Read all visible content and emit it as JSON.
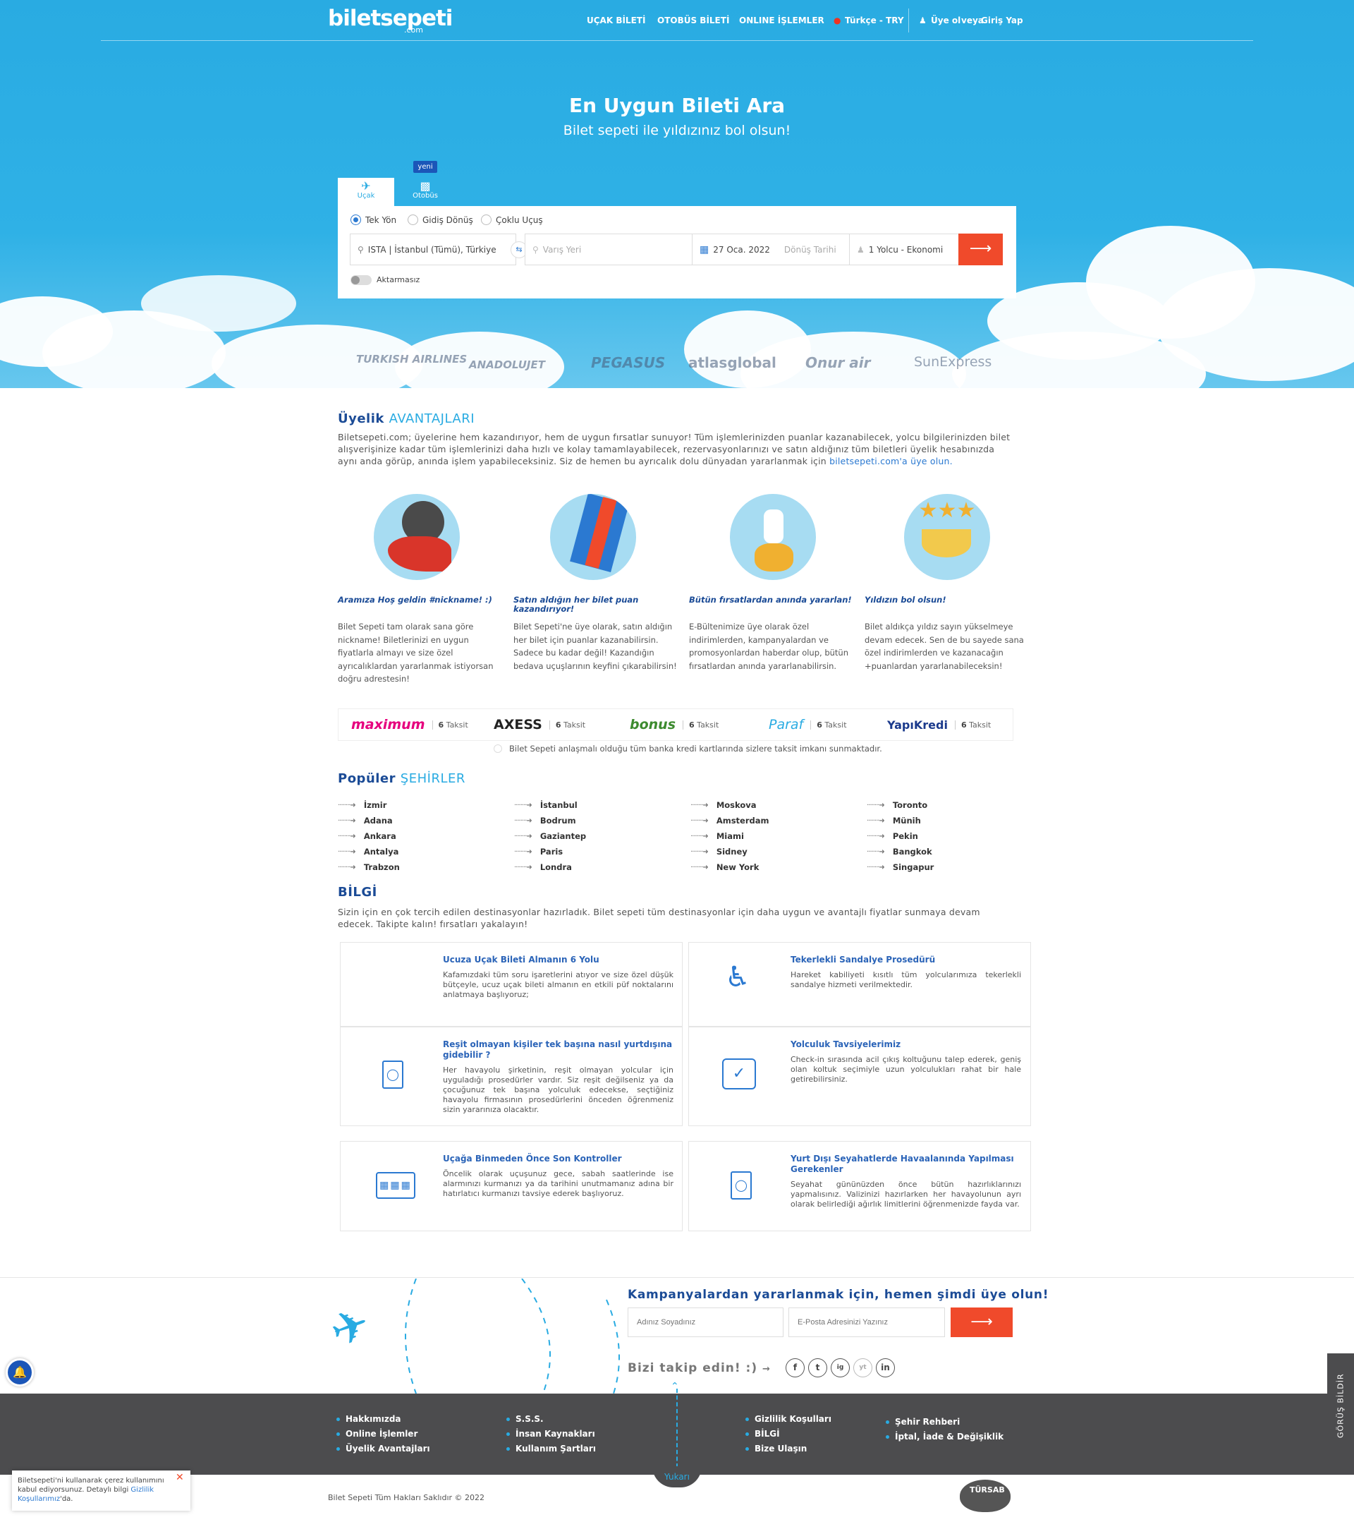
{
  "header": {
    "logo": "biletsepeti",
    "logo_sub": ".com",
    "nav": {
      "flight": "UÇAK BİLETİ",
      "bus": "OTOBÜS BİLETİ",
      "online": "ONLINE İŞLEMLER",
      "language": "Türkçe - TRY",
      "signup": "Üye ol",
      "or": "veya",
      "login": "Giriş Yap"
    }
  },
  "hero": {
    "title": "En Uygun Bileti Ara",
    "subtitle": "Bilet sepeti ile yıldızınız bol olsun!"
  },
  "search": {
    "tabs": {
      "flight": "Uçak",
      "bus": "Otobüs",
      "new_badge": "yeni"
    },
    "trip_types": {
      "one_way": "Tek Yön",
      "round_trip": "Gidiş Dönüş",
      "multi": "Çoklu Uçuş"
    },
    "from_value": "ISTA | İstanbul (Tümü), Türkiye",
    "to_placeholder": "Varış Yeri",
    "depart_date": "27 Oca. 2022",
    "return_placeholder": "Dönüş Tarihi",
    "passengers": "1 Yolcu - Ekonomi",
    "direct_label": "Aktarmasız"
  },
  "airlines": [
    "TURKISH AIRLINES",
    "ANADOLUJET",
    "PEGASUS",
    "atlasglobal",
    "Onur air",
    "SunExpress"
  ],
  "advantages": {
    "title_main": "Üyelik",
    "title_accent": "AVANTAJLARI",
    "intro": "Biletsepeti.com; üyelerine hem kazandırıyor, hem de uygun fırsatlar sunuyor! Tüm işlemlerinizden puanlar kazanabilecek, yolcu bilgilerinizden bilet alışverişinize kadar tüm işlemlerinizi daha hızlı ve kolay tamamlayabilecek, rezervasyonlarınızı ve satın aldığınız tüm biletleri üyelik hesabınızda aynı anda görüp, anında işlem yapabileceksiniz. Siz de hemen bu ayrıcalık dolu dünyadan yararlanmak için",
    "intro_link": "biletsepeti.com'a üye olun.",
    "items": [
      {
        "title": "Aramıza Hoş geldin #nickname! :)",
        "text": "Bilet Sepeti tam olarak sana göre nickname! Biletlerinizi en uygun fiyatlarla almayı ve size özel ayrıcalıklardan yararlanmak istiyorsan doğru adrestesin!"
      },
      {
        "title": "Satın aldığın her bilet puan kazandırıyor!",
        "text": "Bilet Sepeti'ne üye olarak, satın aldığın her bilet için puanlar kazanabilirsin. Sadece bu kadar değil! Kazandığın bedava uçuşlarının keyfini çıkarabilirsin!"
      },
      {
        "title": "Bütün fırsatlardan anında yararlan!",
        "text": "E-Bültenimize üye olarak özel indirimlerden, kampanyalardan ve promosyonlardan haberdar olup, bütün fırsatlardan anında yararlanabilirsin."
      },
      {
        "title": "Yıldızın bol olsun!",
        "text": "Bilet aldıkça yıldız sayın yükselmeye devam edecek. Sen de bu sayede sana özel indirimlerden ve kazanacağın +puanlardan yararlanabileceksin!"
      }
    ]
  },
  "banks": {
    "items": [
      {
        "name": "maximum",
        "count": "6",
        "label": "Taksit",
        "color": "#e6007e"
      },
      {
        "name": "AXESS",
        "count": "6",
        "label": "Taksit",
        "color": "#222222"
      },
      {
        "name": "bonus",
        "count": "6",
        "label": "Taksit",
        "color": "#3d8b2f"
      },
      {
        "name": "Paraf",
        "count": "6",
        "label": "Taksit",
        "color": "#29abe2"
      },
      {
        "name": "YapıKredi",
        "count": "6",
        "label": "Taksit",
        "color": "#1b3a8c"
      }
    ],
    "note": "Bilet Sepeti anlaşmalı olduğu tüm banka kredi kartlarında sizlere taksit imkanı sunmaktadır."
  },
  "cities": {
    "title_main": "Popüler",
    "title_accent": "ŞEHİRLER",
    "columns": [
      [
        "İzmir",
        "Adana",
        "Ankara",
        "Antalya",
        "Trabzon"
      ],
      [
        "İstanbul",
        "Bodrum",
        "Gaziantep",
        "Paris",
        "Londra"
      ],
      [
        "Moskova",
        "Amsterdam",
        "Miami",
        "Sidney",
        "New York"
      ],
      [
        "Toronto",
        "Münih",
        "Pekin",
        "Bangkok",
        "Singapur"
      ]
    ]
  },
  "info": {
    "title": "BİLGİ",
    "intro": "Sizin için en çok tercih edilen destinasyonlar hazırladık. Bilet sepeti tüm destinasyonlar için daha uygun ve avantajlı fiyatlar sunmaya devam edecek. Takipte kalın! fırsatları yakalayın!",
    "cards": [
      {
        "title": "Ucuza Uçak Bileti Almanın 6 Yolu",
        "text": "Kafamızdaki tüm soru işaretlerini atıyor ve size özel düşük bütçeyle, ucuz uçak bileti almanın en etkili püf noktalarını anlatmaya başlıyoruz;",
        "icon": "blank"
      },
      {
        "title": "Tekerlekli Sandalye Prosedürü",
        "text": "Hareket kabiliyeti kısıtlı tüm yolcularımıza tekerlekli sandalye hizmeti verilmektedir.",
        "icon": "wheelchair-icon"
      },
      {
        "title": "Reşit olmayan kişiler tek başına nasıl yurtdışına gidebilir ?",
        "text": "Her havayolu şirketinin, reşit olmayan yolcular için uyguladığı prosedürler vardır. Siz reşit değilseniz ya da çocuğunuz tek başına yolculuk edecekse, seçtiğiniz havayolu firmasının prosedürlerini önceden öğrenmeniz sizin yararınıza olacaktır.",
        "icon": "passport-icon"
      },
      {
        "title": "Yolculuk Tavsiyelerimiz",
        "text": "Check-in sırasında acil çıkış koltuğunu talep ederek, geniş olan koltuk seçimiyle uzun yolculukları rahat bir hale getirebilirsiniz.",
        "icon": "advice-icon"
      },
      {
        "title": "Uçağa Binmeden Önce Son Kontroller",
        "text": "Öncelik olarak uçuşunuz gece, sabah saatlerinde ise alarmınızı kurmanızı ya da tarihini unutmamanız adına bir hatırlatıcı kurmanızı tavsiye ederek başlıyoruz.",
        "icon": "calendar-icon"
      },
      {
        "title": "Yurt Dışı Seyahatlerde Havaalanında Yapılması Gerekenler",
        "text": "Seyahat gününüzden önce bütün hazırlıklarınızı yapmalısınız. Valizinizi hazırlarken her havayolunun ayrı olarak belirlediği ağırlık limitlerini öğrenmenizde fayda var.",
        "icon": "passport-icon"
      }
    ]
  },
  "newsletter": {
    "title": "Kampanyalardan yararlanmak için, hemen şimdi üye olun!",
    "name_placeholder": "Adınız Soyadınız",
    "email_placeholder": "E-Posta Adresinizi Yazınız",
    "follow": "Bizi takip edin! :)",
    "socials": [
      "f",
      "t",
      "ig",
      "yt",
      "in"
    ]
  },
  "footer": {
    "col1": [
      "Hakkımızda",
      "Online İşlemler",
      "Üyelik Avantajları"
    ],
    "col2": [
      "S.S.S.",
      "İnsan Kaynakları",
      "Kullanım Şartları"
    ],
    "col3": [
      "Gizlilik Koşulları",
      "BİLGİ",
      "Bize Ulaşın"
    ],
    "col4": [
      "Şehir Rehberi",
      "İptal, İade & Değişiklik"
    ],
    "up": "Yukarı",
    "copyright": "Bilet Sepeti Tüm Hakları Saklıdır © 2022",
    "tursab": "TÜRSAB",
    "feedback": "GÖRÜŞ BİLDİR"
  },
  "cookie": {
    "text": "Biletsepeti'ni kullanarak çerez kullanımını kabul ediyorsunuz. Detaylı bilgi",
    "link": "Gizlilik Koşullarımız",
    "suffix": "'da."
  },
  "colors": {
    "brand": "#29abe2",
    "accent": "#f04a2b",
    "navy": "#1b4b96",
    "footer": "#4c4c4e"
  }
}
